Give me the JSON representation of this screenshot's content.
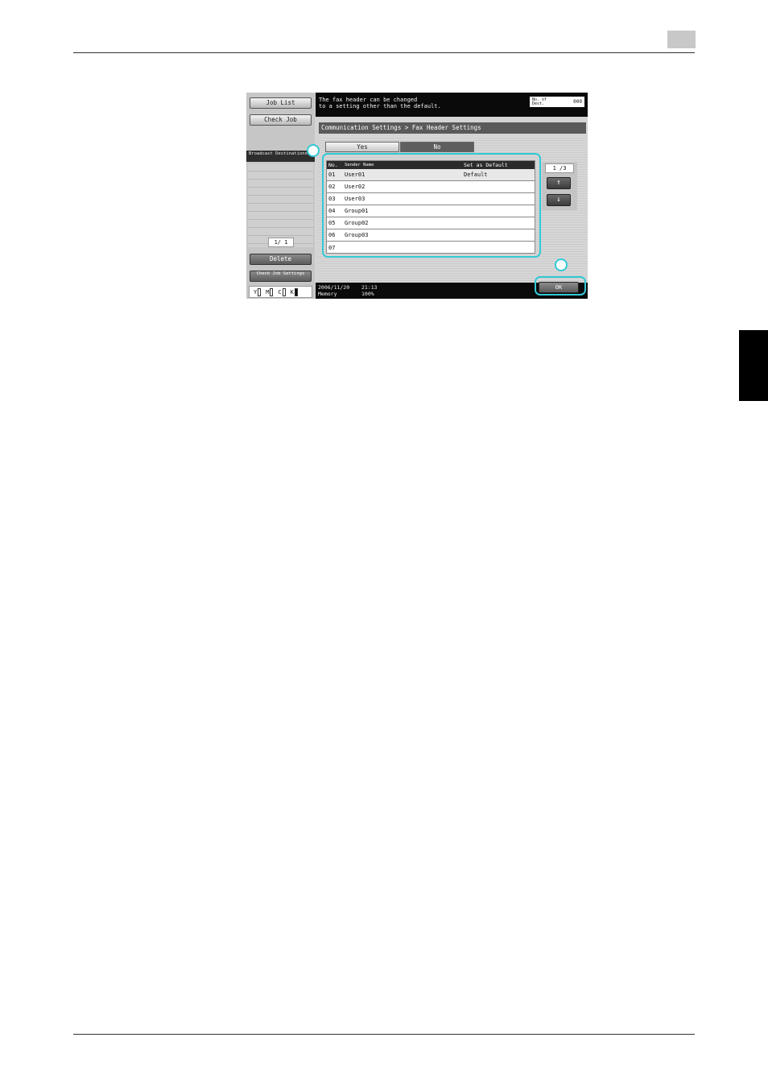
{
  "left_panel": {
    "job_list": "Job List",
    "check_job": "Check Job",
    "broadcast": "Broadcast Destinations",
    "page": "1/   1",
    "delete": "Delete",
    "check_job_settings": "Check Job Settings",
    "toner": [
      "Y",
      "M",
      "C",
      "K"
    ]
  },
  "message": {
    "line1": "The fax header can be changed",
    "line2": "to a setting other than the default."
  },
  "dest": {
    "label_line1": "No. of",
    "label_line2": "Dest.",
    "value": "000"
  },
  "breadcrumb": "Communication Settings > Fax Header Settings",
  "tabs": {
    "yes": "Yes",
    "no": "No"
  },
  "table": {
    "headers": {
      "no": "No.",
      "name": "Sender Name",
      "default": "Set as Default"
    },
    "rows": [
      {
        "no": "01",
        "name": "User01",
        "default": "Default"
      },
      {
        "no": "02",
        "name": "User02",
        "default": ""
      },
      {
        "no": "03",
        "name": "User03",
        "default": ""
      },
      {
        "no": "04",
        "name": "Group01",
        "default": ""
      },
      {
        "no": "05",
        "name": "Group02",
        "default": ""
      },
      {
        "no": "06",
        "name": "Group03",
        "default": ""
      },
      {
        "no": "07",
        "name": "",
        "default": ""
      }
    ]
  },
  "pager": {
    "page": "1 /3",
    "up": "↑",
    "down": "↓"
  },
  "status": {
    "date": "2006/11/20",
    "time": "21:13",
    "memory_label": "Memory",
    "memory_value": "100%"
  },
  "ok": "OK",
  "colors": {
    "callout": "#33c9d6"
  }
}
